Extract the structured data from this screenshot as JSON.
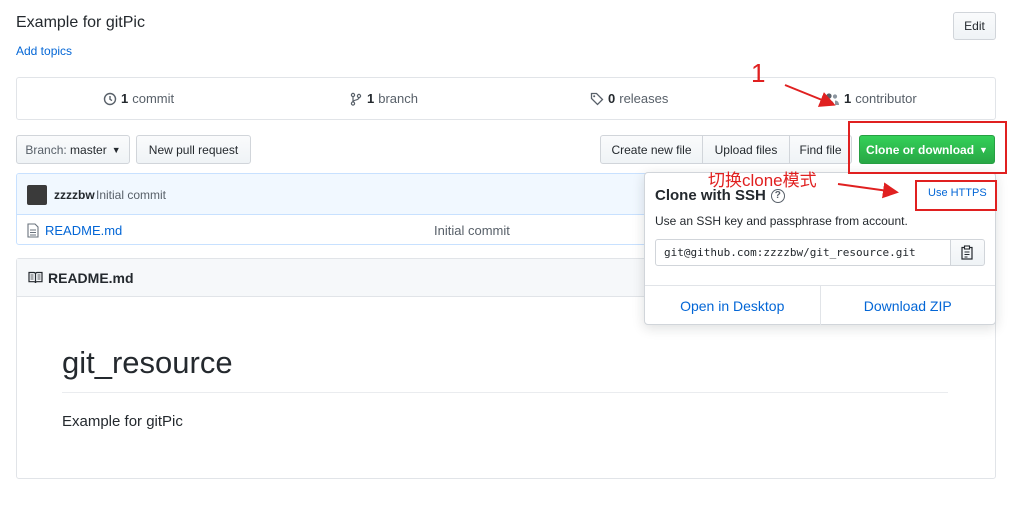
{
  "repo": {
    "description": "Example for gitPic",
    "add_topics": "Add topics",
    "edit": "Edit"
  },
  "numbers": {
    "commits": {
      "count": "1",
      "label": "commit"
    },
    "branches": {
      "count": "1",
      "label": "branch"
    },
    "releases": {
      "count": "0",
      "label": "releases"
    },
    "contributors": {
      "count": "1",
      "label": "contributor"
    }
  },
  "toolbar": {
    "branch_prefix": "Branch:",
    "branch_name": "master",
    "new_pull_request": "New pull request",
    "create_new_file": "Create new file",
    "upload_files": "Upload files",
    "find_file": "Find file",
    "clone_or_download": "Clone or download"
  },
  "commit": {
    "author": "zzzzbw",
    "message": "Initial commit"
  },
  "files": [
    {
      "name": "README.md",
      "commit_message": "Initial commit"
    }
  ],
  "readme": {
    "title": "README.md",
    "h1": "git_resource",
    "paragraph": "Example for gitPic"
  },
  "clone_popup": {
    "title": "Clone with SSH",
    "help": "?",
    "switch_link": "Use HTTPS",
    "description": "Use an SSH key and passphrase from account.",
    "url": "git@github.com:zzzzbw/git_resource.git",
    "open_desktop": "Open in Desktop",
    "download_zip": "Download ZIP"
  },
  "annotations": {
    "number_label": "1",
    "switch_label": "切换clone模式",
    "color": "#e02020"
  },
  "colors": {
    "link": "#0366d6",
    "green": "#28a745"
  }
}
